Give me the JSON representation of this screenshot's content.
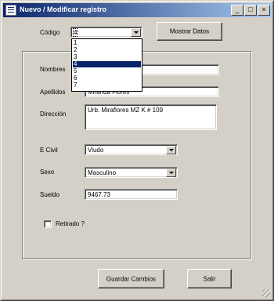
{
  "window": {
    "title": "Nuevo / Modificar registro",
    "buttons": {
      "minimize": "_",
      "maximize": "□",
      "close": "×"
    }
  },
  "codigo": {
    "label": "Código",
    "value": "4",
    "options": [
      "1",
      "2",
      "3",
      "4",
      "5",
      "6",
      "7"
    ],
    "selected_index": 3
  },
  "mostrar_button": "Mostrar Datos",
  "form": {
    "nombres_label": "Nombres",
    "nombres_value": "",
    "apellidos_label": "Apellidos",
    "apellidos_value": "Miranda Flores",
    "direccion_label": "Dirección",
    "direccion_value": "Urb. Miraflores MZ K # 109",
    "ecivil_label": "E Civil",
    "ecivil_value": "Viudo",
    "sexo_label": "Sexo",
    "sexo_value": "Masculino",
    "sueldo_label": "Sueldo",
    "sueldo_value": "9467.73",
    "retirado_label": "Retirado ?",
    "retirado_checked": false
  },
  "footer": {
    "guardar": "Guardar Cambios",
    "salir": "Salir"
  },
  "colors": {
    "titlebar_start": "#0a246a",
    "titlebar_end": "#a6caf0",
    "face": "#d4d0c8",
    "selection": "#0a246a"
  }
}
